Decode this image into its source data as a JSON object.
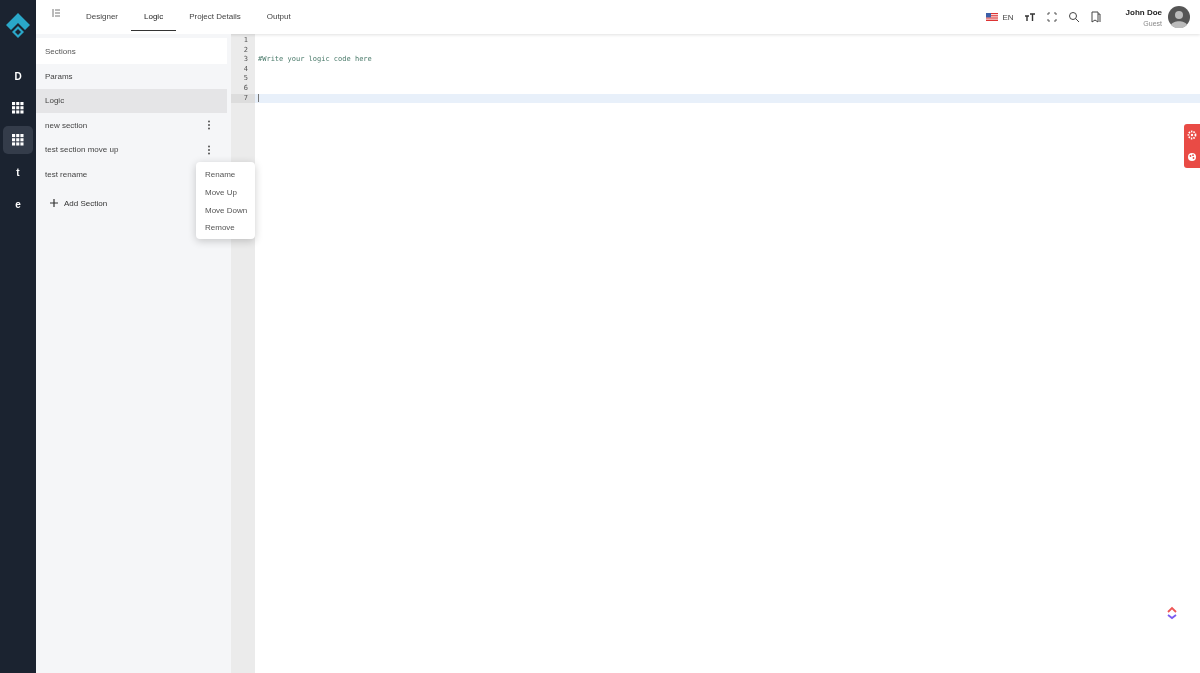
{
  "rail": [
    {
      "kind": "letter",
      "label": "D",
      "selected": false
    },
    {
      "kind": "grid",
      "selected": false
    },
    {
      "kind": "grid",
      "selected": true
    },
    {
      "kind": "letter",
      "label": "t",
      "selected": false
    },
    {
      "kind": "letter",
      "label": "e",
      "selected": false
    }
  ],
  "tabs": [
    {
      "label": "Designer",
      "selected": false
    },
    {
      "label": "Logic",
      "selected": true
    },
    {
      "label": "Project Details",
      "selected": false
    },
    {
      "label": "Output",
      "selected": false
    }
  ],
  "header": {
    "language": "EN",
    "user": {
      "name": "John Doe",
      "role": "Guest"
    }
  },
  "sections": {
    "title": "Sections",
    "items": [
      {
        "label": "Params",
        "selected": false,
        "has_menu": false
      },
      {
        "label": "Logic",
        "selected": true,
        "has_menu": false
      },
      {
        "label": "new section",
        "selected": false,
        "has_menu": true
      },
      {
        "label": "test section move up",
        "selected": false,
        "has_menu": true
      },
      {
        "label": "test rename",
        "selected": false,
        "has_menu": false
      }
    ],
    "add_label": "Add Section"
  },
  "context_menu": [
    "Rename",
    "Move Up",
    "Move Down",
    "Remove"
  ],
  "editor": {
    "lines": [
      {
        "number": "1",
        "active": false
      },
      {
        "number": "2",
        "active": false
      },
      {
        "number": "3",
        "text": "#Write your logic code here",
        "active": false
      },
      {
        "number": "4",
        "active": false
      },
      {
        "number": "5",
        "active": false
      },
      {
        "number": "6",
        "active": false
      },
      {
        "number": "7",
        "active": true
      }
    ]
  }
}
